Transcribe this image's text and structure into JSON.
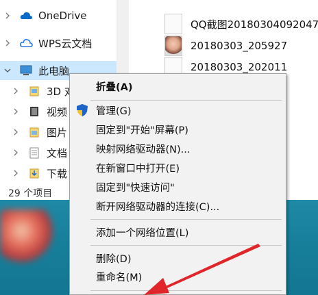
{
  "nav": {
    "items": [
      {
        "label": "OneDrive"
      },
      {
        "label": "WPS云文档"
      },
      {
        "label": "此电脑"
      },
      {
        "label": "3D 对"
      },
      {
        "label": "视频"
      },
      {
        "label": "图片"
      },
      {
        "label": "文档"
      },
      {
        "label": "下载"
      }
    ]
  },
  "status": {
    "count": "29 个项目"
  },
  "files": [
    {
      "name": "QQ截图20180304092047"
    },
    {
      "name": "20180303_205927"
    },
    {
      "name": "20180303_202011"
    }
  ],
  "context_menu": {
    "items": [
      {
        "label": "折叠(A)"
      },
      {
        "label": "管理(G)"
      },
      {
        "label": "固定到\"开始\"屏幕(P)"
      },
      {
        "label": "映射网络驱动器(N)..."
      },
      {
        "label": "在新窗口中打开(E)"
      },
      {
        "label": "固定到\"快速访问\""
      },
      {
        "label": "断开网络驱动器的连接(C)..."
      },
      {
        "label": "添加一个网络位置(L)"
      },
      {
        "label": "删除(D)"
      },
      {
        "label": "重命名(M)"
      }
    ]
  },
  "colors": {
    "desktop": "#1a86a2",
    "arrow": "#e0262a",
    "selection": "#cce8ff"
  }
}
